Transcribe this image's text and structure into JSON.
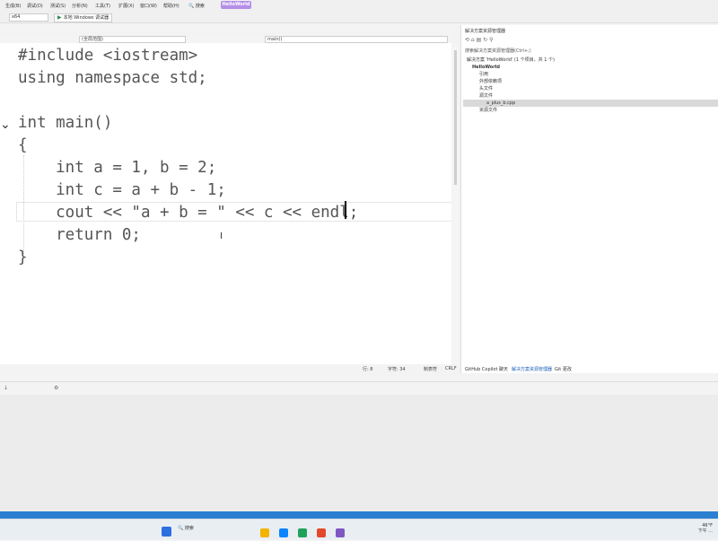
{
  "menu": {
    "items": [
      "生成(B)",
      "调试(D)",
      "测试(S)",
      "分析(N)",
      "工具(T)",
      "扩展(X)",
      "窗口(W)",
      "帮助(H)"
    ],
    "search_label": "搜索",
    "solution_name": "HelloWorld"
  },
  "toolbar": {
    "platform": "x64",
    "run_label": "本地 Windows 调试器"
  },
  "nav": {
    "scope": "(全局范围)",
    "function": "main()"
  },
  "code": {
    "lines": [
      "#include <iostream>",
      "using namespace std;",
      "",
      "int main()",
      "{",
      "    int a = 1, b = 2;",
      "    int c = a + b - 1;",
      "    cout << \"a + b = \" << c << endl;",
      "    return 0;",
      "}"
    ]
  },
  "status": {
    "line": "行: 8",
    "col": "字符: 34",
    "mode": "制表符",
    "eol": "CRLF"
  },
  "solution_explorer": {
    "title": "解决方案资源管理器",
    "search_placeholder": "搜索解决方案资源管理器(Ctrl+;)",
    "tree": [
      {
        "text": "解决方案 'HelloWorld' (1 个项目，共 1 个)",
        "indent": 1
      },
      {
        "text": "HelloWorld",
        "indent": 2
      },
      {
        "text": "引用",
        "indent": 3
      },
      {
        "text": "外部依赖项",
        "indent": 3
      },
      {
        "text": "头文件",
        "indent": 3
      },
      {
        "text": "源文件",
        "indent": 3
      },
      {
        "text": "a_plus_b.cpp",
        "indent": 4
      },
      {
        "text": "资源文件",
        "indent": 3
      }
    ],
    "tabs": [
      "GitHub Copilot 聊天",
      "解决方案资源管理器",
      "Git 更改"
    ]
  },
  "taskbar": {
    "search": "搜索",
    "temp": "46°F",
    "time": "下午 ..."
  }
}
